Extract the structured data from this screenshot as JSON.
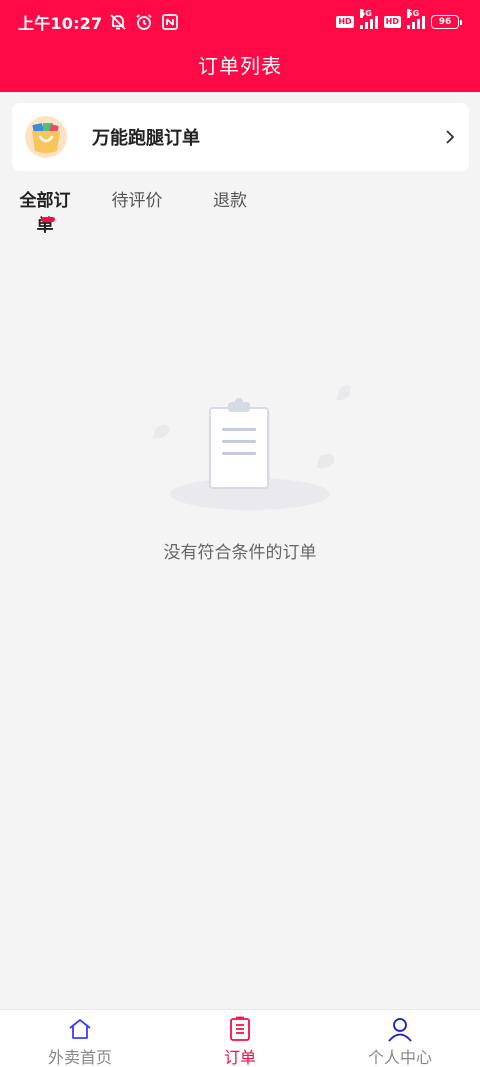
{
  "colors": {
    "brand": "#ff0a46",
    "home_icon": "#3d3dff",
    "profile_icon": "#1a1acc"
  },
  "status_bar": {
    "time": "上午10:27",
    "left_icons": [
      "mute-bell-icon",
      "alarm-icon",
      "nfc-icon"
    ],
    "sim1": {
      "badge": "HD",
      "network": "5G"
    },
    "sim2": {
      "badge": "HD",
      "network": "5G"
    },
    "battery": "96"
  },
  "header": {
    "title": "订单列表"
  },
  "errand_card": {
    "icon": "shopping-bag-icon",
    "label": "万能跑腿订单"
  },
  "tabs": [
    {
      "label": "全部订单",
      "active": true
    },
    {
      "label": "待评价",
      "active": false
    },
    {
      "label": "退款",
      "active": false
    }
  ],
  "empty_state": {
    "icon": "clipboard-icon",
    "message": "没有符合条件的订单"
  },
  "bottom_nav": [
    {
      "label": "外卖首页",
      "icon": "home-icon",
      "active": false
    },
    {
      "label": "订单",
      "icon": "order-list-icon",
      "active": true
    },
    {
      "label": "个人中心",
      "icon": "profile-icon",
      "active": false
    }
  ]
}
